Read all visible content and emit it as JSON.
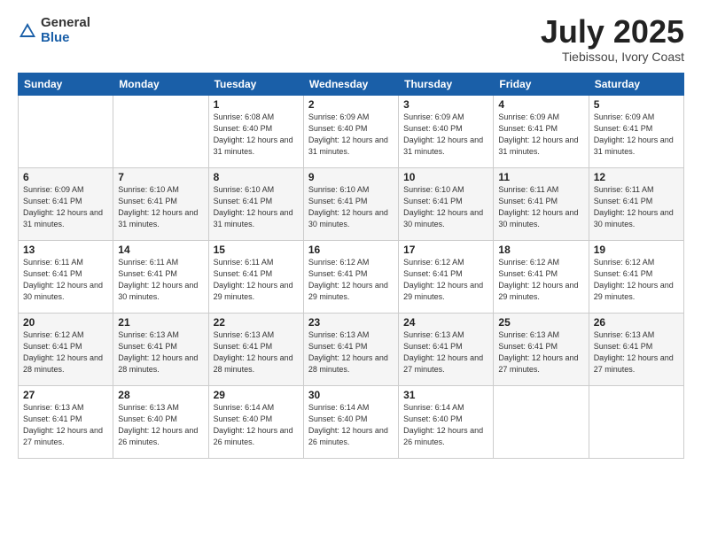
{
  "logo": {
    "general": "General",
    "blue": "Blue"
  },
  "title": {
    "month_year": "July 2025",
    "location": "Tiebissou, Ivory Coast"
  },
  "weekdays": [
    "Sunday",
    "Monday",
    "Tuesday",
    "Wednesday",
    "Thursday",
    "Friday",
    "Saturday"
  ],
  "weeks": [
    [
      {
        "day": "",
        "info": ""
      },
      {
        "day": "",
        "info": ""
      },
      {
        "day": "1",
        "info": "Sunrise: 6:08 AM\nSunset: 6:40 PM\nDaylight: 12 hours and 31 minutes."
      },
      {
        "day": "2",
        "info": "Sunrise: 6:09 AM\nSunset: 6:40 PM\nDaylight: 12 hours and 31 minutes."
      },
      {
        "day": "3",
        "info": "Sunrise: 6:09 AM\nSunset: 6:40 PM\nDaylight: 12 hours and 31 minutes."
      },
      {
        "day": "4",
        "info": "Sunrise: 6:09 AM\nSunset: 6:41 PM\nDaylight: 12 hours and 31 minutes."
      },
      {
        "day": "5",
        "info": "Sunrise: 6:09 AM\nSunset: 6:41 PM\nDaylight: 12 hours and 31 minutes."
      }
    ],
    [
      {
        "day": "6",
        "info": "Sunrise: 6:09 AM\nSunset: 6:41 PM\nDaylight: 12 hours and 31 minutes."
      },
      {
        "day": "7",
        "info": "Sunrise: 6:10 AM\nSunset: 6:41 PM\nDaylight: 12 hours and 31 minutes."
      },
      {
        "day": "8",
        "info": "Sunrise: 6:10 AM\nSunset: 6:41 PM\nDaylight: 12 hours and 31 minutes."
      },
      {
        "day": "9",
        "info": "Sunrise: 6:10 AM\nSunset: 6:41 PM\nDaylight: 12 hours and 30 minutes."
      },
      {
        "day": "10",
        "info": "Sunrise: 6:10 AM\nSunset: 6:41 PM\nDaylight: 12 hours and 30 minutes."
      },
      {
        "day": "11",
        "info": "Sunrise: 6:11 AM\nSunset: 6:41 PM\nDaylight: 12 hours and 30 minutes."
      },
      {
        "day": "12",
        "info": "Sunrise: 6:11 AM\nSunset: 6:41 PM\nDaylight: 12 hours and 30 minutes."
      }
    ],
    [
      {
        "day": "13",
        "info": "Sunrise: 6:11 AM\nSunset: 6:41 PM\nDaylight: 12 hours and 30 minutes."
      },
      {
        "day": "14",
        "info": "Sunrise: 6:11 AM\nSunset: 6:41 PM\nDaylight: 12 hours and 30 minutes."
      },
      {
        "day": "15",
        "info": "Sunrise: 6:11 AM\nSunset: 6:41 PM\nDaylight: 12 hours and 29 minutes."
      },
      {
        "day": "16",
        "info": "Sunrise: 6:12 AM\nSunset: 6:41 PM\nDaylight: 12 hours and 29 minutes."
      },
      {
        "day": "17",
        "info": "Sunrise: 6:12 AM\nSunset: 6:41 PM\nDaylight: 12 hours and 29 minutes."
      },
      {
        "day": "18",
        "info": "Sunrise: 6:12 AM\nSunset: 6:41 PM\nDaylight: 12 hours and 29 minutes."
      },
      {
        "day": "19",
        "info": "Sunrise: 6:12 AM\nSunset: 6:41 PM\nDaylight: 12 hours and 29 minutes."
      }
    ],
    [
      {
        "day": "20",
        "info": "Sunrise: 6:12 AM\nSunset: 6:41 PM\nDaylight: 12 hours and 28 minutes."
      },
      {
        "day": "21",
        "info": "Sunrise: 6:13 AM\nSunset: 6:41 PM\nDaylight: 12 hours and 28 minutes."
      },
      {
        "day": "22",
        "info": "Sunrise: 6:13 AM\nSunset: 6:41 PM\nDaylight: 12 hours and 28 minutes."
      },
      {
        "day": "23",
        "info": "Sunrise: 6:13 AM\nSunset: 6:41 PM\nDaylight: 12 hours and 28 minutes."
      },
      {
        "day": "24",
        "info": "Sunrise: 6:13 AM\nSunset: 6:41 PM\nDaylight: 12 hours and 27 minutes."
      },
      {
        "day": "25",
        "info": "Sunrise: 6:13 AM\nSunset: 6:41 PM\nDaylight: 12 hours and 27 minutes."
      },
      {
        "day": "26",
        "info": "Sunrise: 6:13 AM\nSunset: 6:41 PM\nDaylight: 12 hours and 27 minutes."
      }
    ],
    [
      {
        "day": "27",
        "info": "Sunrise: 6:13 AM\nSunset: 6:41 PM\nDaylight: 12 hours and 27 minutes."
      },
      {
        "day": "28",
        "info": "Sunrise: 6:13 AM\nSunset: 6:40 PM\nDaylight: 12 hours and 26 minutes."
      },
      {
        "day": "29",
        "info": "Sunrise: 6:14 AM\nSunset: 6:40 PM\nDaylight: 12 hours and 26 minutes."
      },
      {
        "day": "30",
        "info": "Sunrise: 6:14 AM\nSunset: 6:40 PM\nDaylight: 12 hours and 26 minutes."
      },
      {
        "day": "31",
        "info": "Sunrise: 6:14 AM\nSunset: 6:40 PM\nDaylight: 12 hours and 26 minutes."
      },
      {
        "day": "",
        "info": ""
      },
      {
        "day": "",
        "info": ""
      }
    ]
  ]
}
